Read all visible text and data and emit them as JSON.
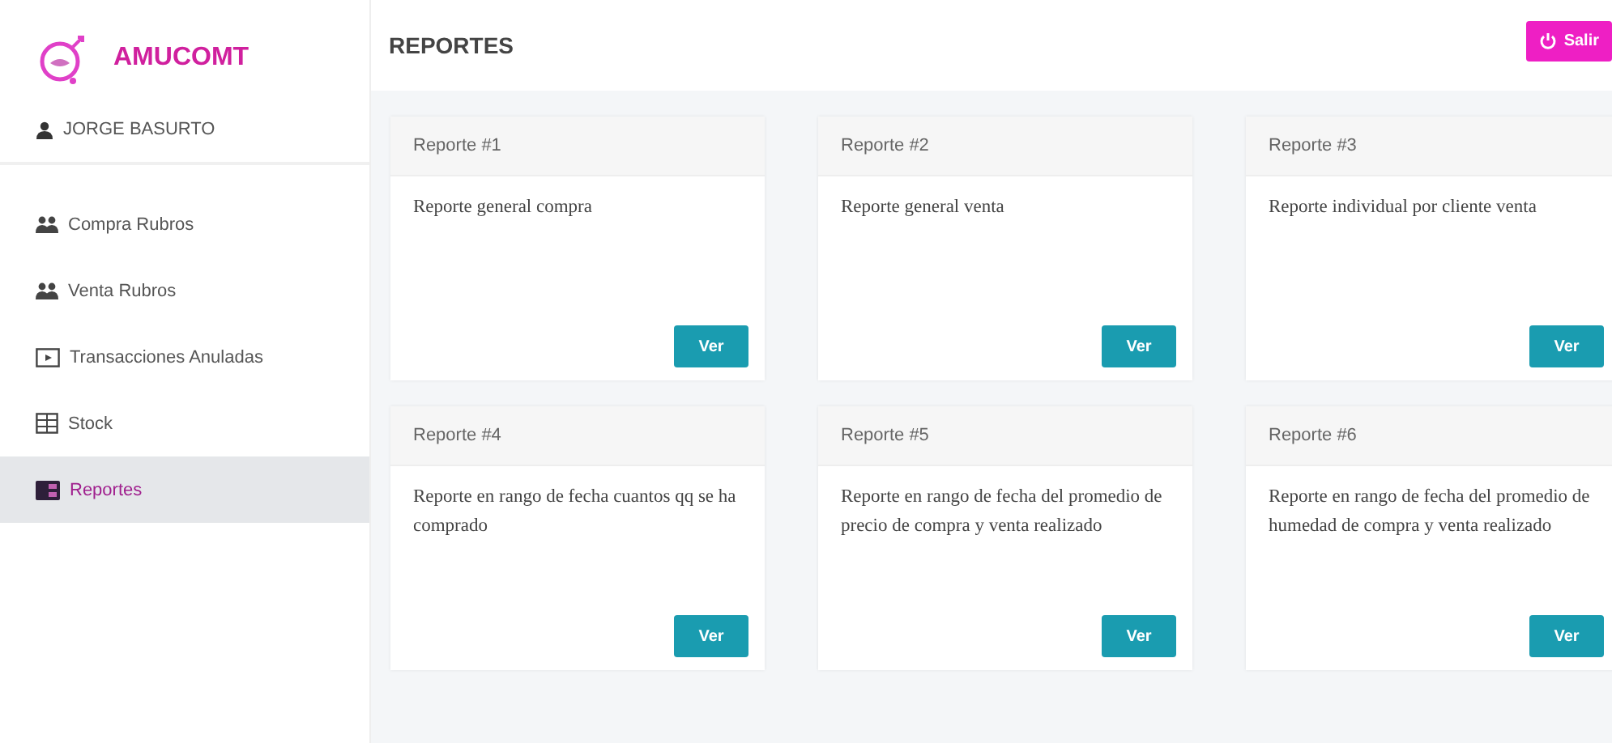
{
  "brand": "AMUCOMT",
  "user": "JORGE BASURTO",
  "sidebar": {
    "items": [
      {
        "label": "Compra Rubros",
        "selected": false
      },
      {
        "label": "Venta Rubros",
        "selected": false
      },
      {
        "label": "Transacciones Anuladas",
        "selected": false
      },
      {
        "label": "Stock",
        "selected": false
      },
      {
        "label": "Reportes",
        "selected": true
      }
    ]
  },
  "header": {
    "title": "REPORTES",
    "logout_button": "Salir"
  },
  "cards": [
    {
      "title": "Reporte #1",
      "text": "Reporte general compra",
      "button": "Ver"
    },
    {
      "title": "Reporte #2",
      "text": "Reporte general venta",
      "button": "Ver"
    },
    {
      "title": "Reporte #3",
      "text": "Reporte individual por cliente venta",
      "button": "Ver"
    },
    {
      "title": "Reporte #4",
      "text": "Reporte en rango de fecha cuantos qq se ha comprado",
      "button": "Ver"
    },
    {
      "title": "Reporte #5",
      "text": "Reporte en rango de fecha del promedio de precio de compra y venta realizado",
      "button": "Ver"
    },
    {
      "title": "Reporte #6",
      "text": "Reporte en rango de fecha del promedio de humedad de compra y venta realizado",
      "button": "Ver"
    }
  ]
}
